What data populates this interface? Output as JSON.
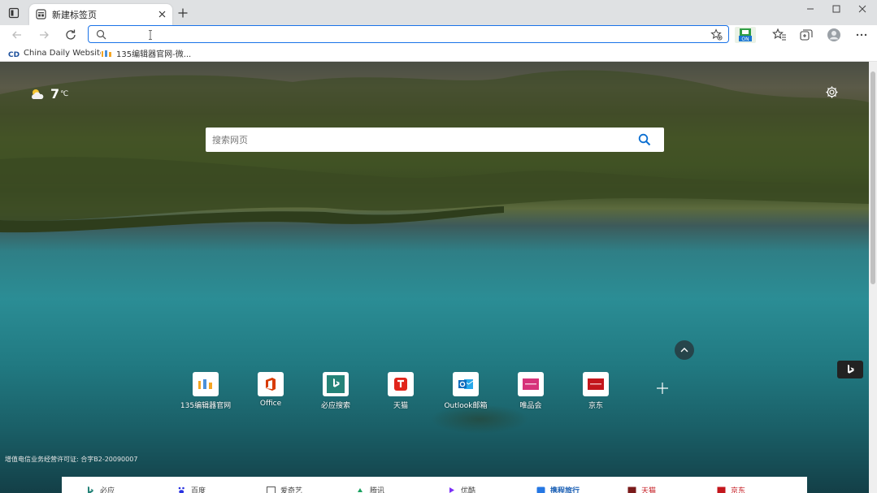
{
  "browser": {
    "tab": {
      "title": "新建标签页"
    },
    "address_bar": {
      "value": "",
      "placeholder": ""
    },
    "extension_badge": "ON",
    "bookmarks": [
      {
        "label": "China Daily Website..."
      },
      {
        "label": "135编辑器官网-微..."
      }
    ]
  },
  "ntp": {
    "weather": {
      "temp": "7",
      "unit": "℃",
      "icon": "partly-cloudy-icon"
    },
    "search": {
      "placeholder": "搜索网页"
    },
    "tiles": [
      {
        "label": "135编辑器官网",
        "icon": "135-editor-icon"
      },
      {
        "label": "Office",
        "icon": "office-icon"
      },
      {
        "label": "必应搜索",
        "icon": "bing-icon"
      },
      {
        "label": "天猫",
        "icon": "tmall-icon"
      },
      {
        "label": "Outlook邮箱",
        "icon": "outlook-icon"
      },
      {
        "label": "唯品会",
        "icon": "vip-icon"
      },
      {
        "label": "京东",
        "icon": "jd-icon"
      }
    ],
    "license": "增值电信业务经营许可证: 合字B2-20090007",
    "bottom_links": [
      {
        "label": "必应"
      },
      {
        "label": "百度"
      },
      {
        "label": "爱奇艺"
      },
      {
        "label": "腾讯"
      },
      {
        "label": "优酷"
      },
      {
        "label": "携程旅行"
      },
      {
        "label": "天猫"
      },
      {
        "label": "京东"
      }
    ]
  },
  "colors": {
    "address_focus": "#1a73e8",
    "search_blue": "#0a6ed1",
    "office_red": "#d83b01",
    "bing_teal": "#258378",
    "tmall_red": "#e1251b",
    "outlook_blue": "#0f6cbd",
    "vip_pink": "#d6337a",
    "jd_red": "#c3161c"
  }
}
